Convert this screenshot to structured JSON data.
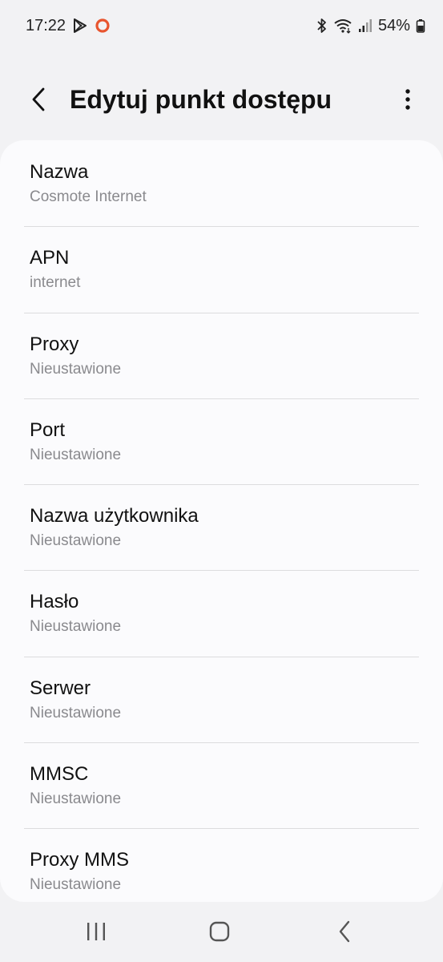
{
  "status_bar": {
    "time": "17:22",
    "battery_percent": "54%",
    "icons": [
      "play-store-icon",
      "notification-circle-icon",
      "bluetooth-icon",
      "wifi-icon",
      "signal-icon",
      "battery-icon"
    ]
  },
  "header": {
    "title": "Edytuj punkt dostępu",
    "back_icon": "back-arrow-icon",
    "more_icon": "more-vertical-icon"
  },
  "settings": {
    "items": [
      {
        "label": "Nazwa",
        "value": "Cosmote Internet"
      },
      {
        "label": "APN",
        "value": "internet"
      },
      {
        "label": "Proxy",
        "value": "Nieustawione"
      },
      {
        "label": "Port",
        "value": "Nieustawione"
      },
      {
        "label": "Nazwa użytkownika",
        "value": "Nieustawione"
      },
      {
        "label": "Hasło",
        "value": "Nieustawione"
      },
      {
        "label": "Serwer",
        "value": "Nieustawione"
      },
      {
        "label": "MMSC",
        "value": "Nieustawione"
      },
      {
        "label": "Proxy MMS",
        "value": "Nieustawione"
      }
    ]
  },
  "nav_bar": {
    "icons": [
      "recents-icon",
      "home-icon",
      "back-icon"
    ]
  },
  "colors": {
    "background": "#f2f2f4",
    "card": "#fbfbfd",
    "secondary_text": "#8a8a8e",
    "divider": "#dcdcde",
    "notification_accent": "#e8552f"
  }
}
